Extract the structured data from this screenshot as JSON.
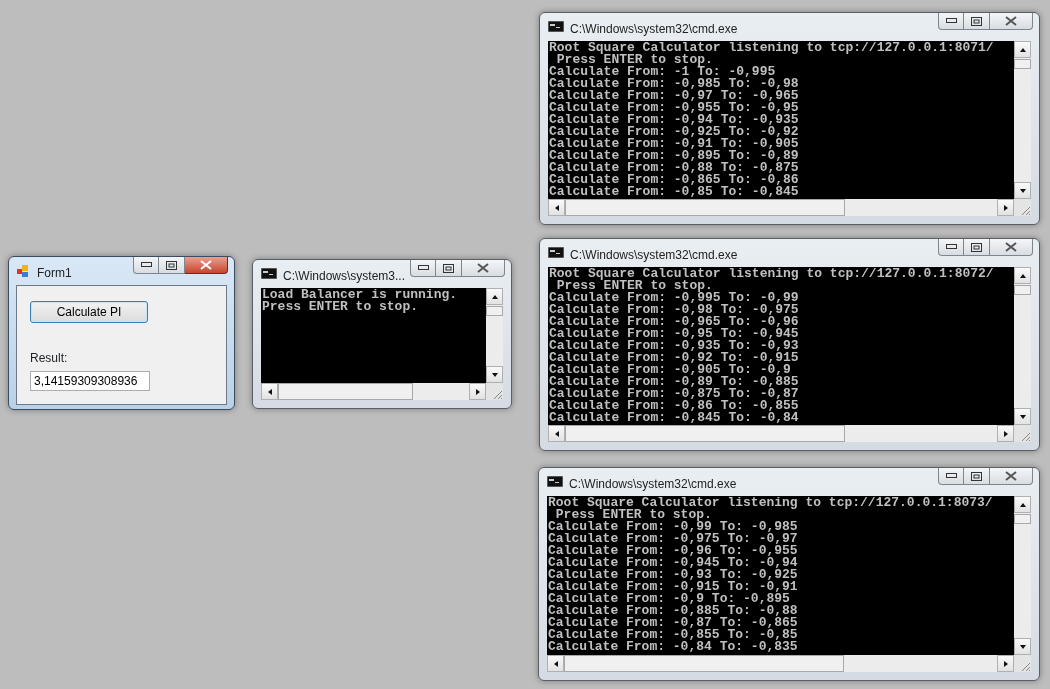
{
  "windows": [
    {
      "kind": "form",
      "title": "Form1",
      "active": true,
      "button": "Calculate PI",
      "result_label": "Result:",
      "result_value": "3,14159309308936"
    },
    {
      "kind": "console",
      "title": "C:\\Windows\\system3...",
      "active": false,
      "lines": [
        "Load Balancer is running.",
        "Press ENTER to stop."
      ]
    },
    {
      "kind": "console",
      "title": "C:\\Windows\\system32\\cmd.exe",
      "active": false,
      "lines": [
        "Root Square Calculator listening to tcp://127.0.0.1:8071/",
        " Press ENTER to stop.",
        "Calculate From: -1 To: -0,995",
        "Calculate From: -0,985 To: -0,98",
        "Calculate From: -0,97 To: -0,965",
        "Calculate From: -0,955 To: -0,95",
        "Calculate From: -0,94 To: -0,935",
        "Calculate From: -0,925 To: -0,92",
        "Calculate From: -0,91 To: -0,905",
        "Calculate From: -0,895 To: -0,89",
        "Calculate From: -0,88 To: -0,875",
        "Calculate From: -0,865 To: -0,86",
        "Calculate From: -0,85 To: -0,845"
      ]
    },
    {
      "kind": "console",
      "title": "C:\\Windows\\system32\\cmd.exe",
      "active": false,
      "lines": [
        "Root Square Calculator listening to tcp://127.0.0.1:8072/",
        " Press ENTER to stop.",
        "Calculate From: -0,995 To: -0,99",
        "Calculate From: -0,98 To: -0,975",
        "Calculate From: -0,965 To: -0,96",
        "Calculate From: -0,95 To: -0,945",
        "Calculate From: -0,935 To: -0,93",
        "Calculate From: -0,92 To: -0,915",
        "Calculate From: -0,905 To: -0,9",
        "Calculate From: -0,89 To: -0,885",
        "Calculate From: -0,875 To: -0,87",
        "Calculate From: -0,86 To: -0,855",
        "Calculate From: -0,845 To: -0,84"
      ]
    },
    {
      "kind": "console",
      "title": "C:\\Windows\\system32\\cmd.exe",
      "active": false,
      "lines": [
        "Root Square Calculator listening to tcp://127.0.0.1:8073/",
        " Press ENTER to stop.",
        "Calculate From: -0,99 To: -0,985",
        "Calculate From: -0,975 To: -0,97",
        "Calculate From: -0,96 To: -0,955",
        "Calculate From: -0,945 To: -0,94",
        "Calculate From: -0,93 To: -0,925",
        "Calculate From: -0,915 To: -0,91",
        "Calculate From: -0,9 To: -0,895",
        "Calculate From: -0,885 To: -0,88",
        "Calculate From: -0,87 To: -0,865",
        "Calculate From: -0,855 To: -0,85",
        "Calculate From: -0,84 To: -0,835"
      ]
    }
  ]
}
